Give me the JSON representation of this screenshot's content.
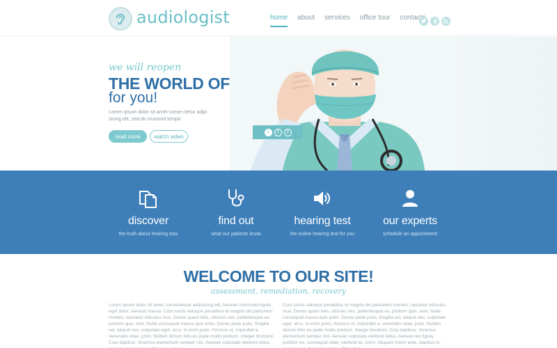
{
  "header": {
    "logo_text": "audiologist",
    "nav": [
      {
        "label": "home",
        "active": true
      },
      {
        "label": "about",
        "active": false
      },
      {
        "label": "services",
        "active": false
      },
      {
        "label": "office tour",
        "active": false
      },
      {
        "label": "contacts",
        "active": false
      }
    ],
    "socials": [
      {
        "icon": "twitter-icon",
        "glyph": "t"
      },
      {
        "icon": "facebook-icon",
        "glyph": "f"
      },
      {
        "icon": "rss-icon",
        "glyph": "r"
      }
    ]
  },
  "hero": {
    "kicker": "we will reopen",
    "title_line1": "THE WORLD OF SOUNDS",
    "title_line2": "for you!",
    "description": "Lorem ipsum dolor sit amet conse ctetur adipi sicing elit, sed do eiusmod tempo.",
    "read_more_label": "read more",
    "watch_video_label": "watch video",
    "pager": [
      "1",
      "2",
      "3"
    ],
    "active_slide": 1
  },
  "features": [
    {
      "icon": "documents-icon",
      "title": "discover",
      "subtitle": "the truth about hearing loss"
    },
    {
      "icon": "stethoscope-icon",
      "title": "find out",
      "subtitle": "what our patients know"
    },
    {
      "icon": "speaker-icon",
      "title": "hearing test",
      "subtitle": "the online hearing test for you"
    },
    {
      "icon": "user-icon",
      "title": "our experts",
      "subtitle": "schedule an appointment"
    }
  ],
  "welcome": {
    "title": "WELCOME TO OUR SITE!",
    "subtitle": "assessment, remediation, recovery",
    "col_left": "Lorem ipsum dolor sit amet, consectetuer adipiscing elit. Aenean commodo ligula eget dolor. Aenean massa. Cum sociis natoque penatibus et magnis dis parturient montes, nascetur ridiculus mus. Donec quam felis, ultricies nec, pellentesque eu, pretium quis, sem. Nulla consequat massa quis enim. Donec pede justo, fringilla vel, aliquet nec, vulputate eget, arcu. In enim justo, rhoncus ut, imperdiet a, venenatis vitae, justo. Nullam dictum felis eu pede mollis pretium. Integer tincidunt. Cras dapibus. Vivamus elementum semper nisi. Aenean vulputate eleifend tellus. Aenean leo ligula, porttitor eu, conse",
    "col_right": "Cum sociis natoque penatibus et magnis dis parturient montes, nascetur ridiculus mus. Donec quam felis, ultricies nec, pellentesque eu, pretium quis, sem. Nulla consequat massa quis enim. Donec pede justo, fringilla vel, aliquet nec, vulputate eget, arcu. In enim justo, rhoncus ut, imperdiet a, venenatis vitae, justo. Nullam dictum felis eu pede mollis pretium. Integer tincidunt. Cras dapibus. Vivamus elementum semper nisi. Aenean vulputate eleifend tellus. Aenean leo ligula, porttitor eu, consequat vitae, eleifend ac, enim. Aliquam lorem ante, dapibus in, viverra quis, feugiat a, tellus. Phasellus"
  },
  "colors": {
    "accent": "#69bfc6",
    "brand_blue": "#2f6fa6",
    "band_blue": "#3e7fb9"
  }
}
